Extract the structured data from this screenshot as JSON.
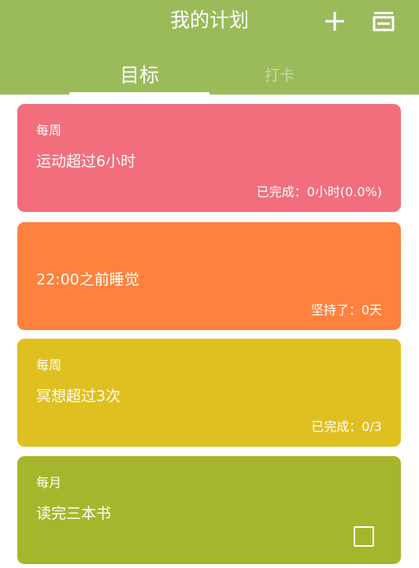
{
  "header": {
    "title": "我的计划",
    "add_icon": "plus-icon",
    "menu_icon": "list-menu-icon",
    "background": "#9bbb5b"
  },
  "tabs": [
    {
      "label": "目标",
      "selected": true
    },
    {
      "label": "打卡",
      "selected": false
    }
  ],
  "cards": [
    {
      "period": "每周",
      "text": "运动超过6小时",
      "status": "已完成：0小时(0.0%)",
      "color": "#f26e7c"
    },
    {
      "period": "",
      "text": "22:00之前睡觉",
      "status": "坚持了：0天",
      "color": "#fe823e"
    },
    {
      "period": "每周",
      "text": "冥想超过3次",
      "status": "已完成：0/3",
      "color": "#e0bf20"
    },
    {
      "period": "每月",
      "text": "读完三本书",
      "status": "",
      "color": "#a6b62c",
      "checkbox": "unchecked"
    }
  ]
}
